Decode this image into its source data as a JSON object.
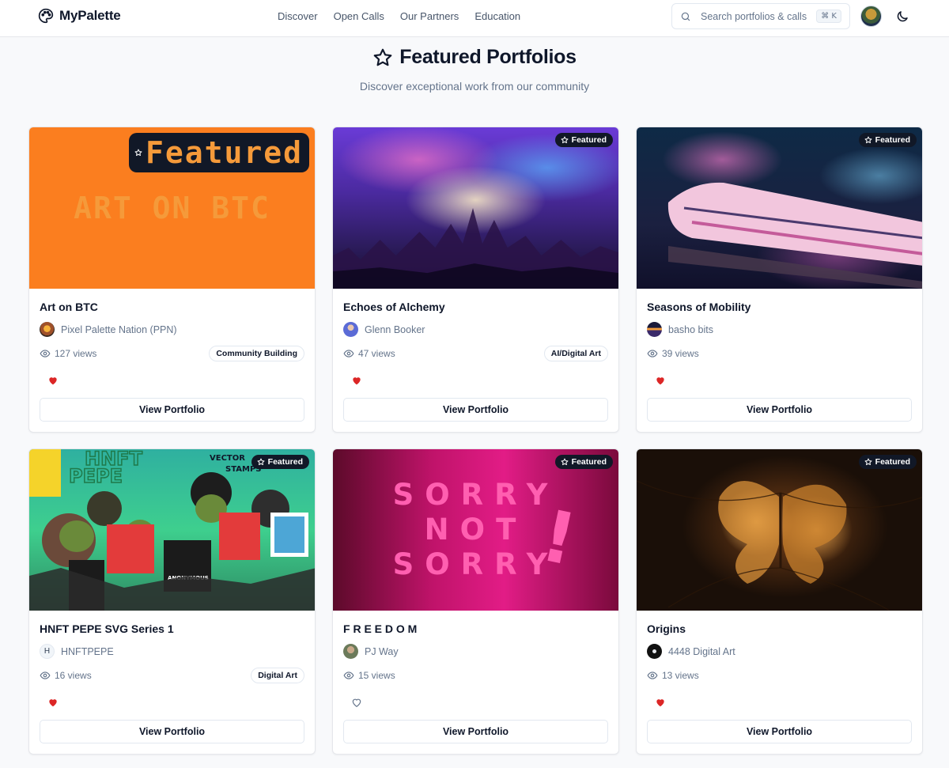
{
  "app": {
    "name": "MyPalette"
  },
  "nav": {
    "items": [
      "Discover",
      "Open Calls",
      "Our Partners",
      "Education"
    ]
  },
  "search": {
    "placeholder": "Search portfolios & calls",
    "shortcut": "⌘ K"
  },
  "section": {
    "title": "Featured Portfolios",
    "subtitle": "Discover exceptional work from our community"
  },
  "labels": {
    "featured_badge": "Featured",
    "view_button": "View Portfolio"
  },
  "cards": [
    {
      "title": "Art on BTC",
      "author": "Pixel Palette Nation (PPN)",
      "views": "127 views",
      "tag": "Community Building",
      "liked": true,
      "art_text": "ART ON BTC"
    },
    {
      "title": "Echoes of Alchemy",
      "author": "Glenn Booker",
      "views": "47 views",
      "tag": "AI/Digital Art",
      "liked": true
    },
    {
      "title": "Seasons of Mobility",
      "author": "basho bits",
      "views": "39 views",
      "tag": "",
      "liked": true
    },
    {
      "title": "HNFT PEPE SVG Series 1",
      "author": "HNFTPEPE",
      "author_initial": "H",
      "views": "16 views",
      "tag": "Digital Art",
      "liked": true,
      "art_text_1": "HNFT",
      "art_text_2": "PEPE",
      "art_text_3": "VECTOR",
      "art_text_4": "STAMPS",
      "art_text_5": "ANONYMOUS"
    },
    {
      "title": "F R E E D O M",
      "author": "PJ Way",
      "views": "15 views",
      "tag": "",
      "liked": false,
      "art_words": [
        "SORRY",
        "NOT",
        "SORRY"
      ],
      "art_mark": "!"
    },
    {
      "title": "Origins",
      "author": "4448 Digital Art",
      "views": "13 views",
      "tag": "",
      "liked": true
    }
  ],
  "colors": {
    "accent": "#0f172a",
    "heart_liked": "#dc2626",
    "badge_bg": "#111827",
    "page_bg": "#f8f9fb"
  }
}
